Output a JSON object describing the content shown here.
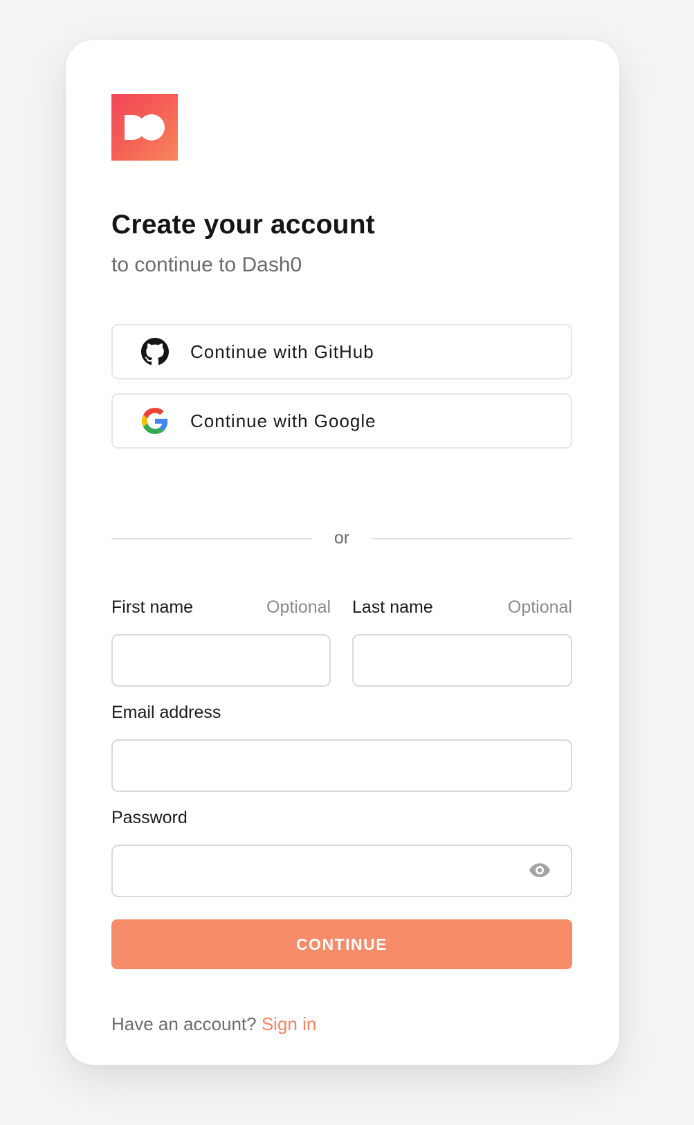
{
  "brand": {
    "logo_icon": "dash0-logo",
    "gradient_start": "#f2475a",
    "gradient_end": "#f8875d"
  },
  "header": {
    "title": "Create your account",
    "subtitle": "to continue to Dash0"
  },
  "social": {
    "github_label": "Continue with GitHub",
    "github_icon": "github-icon",
    "google_label": "Continue with Google",
    "google_icon": "google-icon"
  },
  "divider": {
    "text": "or"
  },
  "form": {
    "first_name": {
      "label": "First name",
      "hint": "Optional",
      "value": ""
    },
    "last_name": {
      "label": "Last name",
      "hint": "Optional",
      "value": ""
    },
    "email": {
      "label": "Email address",
      "value": ""
    },
    "password": {
      "label": "Password",
      "value": "",
      "toggle_icon": "eye-icon"
    },
    "submit_label": "CONTINUE"
  },
  "footer": {
    "prompt": "Have an account?",
    "link_label": "Sign in"
  },
  "colors": {
    "accent": "#f68c6a",
    "link": "#f5835f",
    "text_primary": "#151515",
    "text_secondary": "#6b6b6b"
  }
}
